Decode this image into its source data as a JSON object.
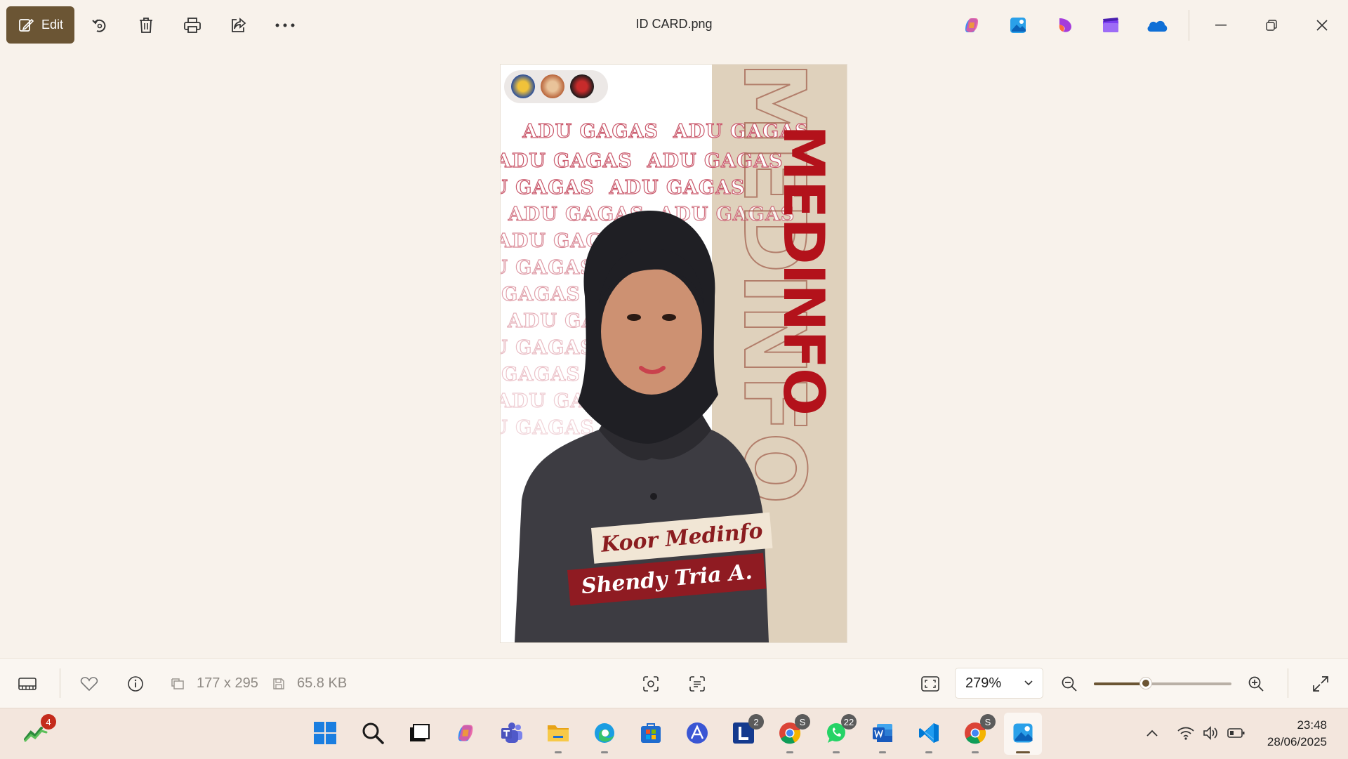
{
  "titlebar": {
    "edit_label": "Edit",
    "file_name": "ID CARD.png",
    "toolbar_icons": [
      "rotate-icon",
      "delete-icon",
      "print-icon",
      "share-icon",
      "more-icon"
    ],
    "app_icons": [
      "copilot-icon",
      "photos-icon",
      "designer-icon",
      "clipchamp-icon",
      "onedrive-icon"
    ],
    "window_controls": [
      "minimize-icon",
      "restore-icon",
      "close-icon"
    ]
  },
  "photo": {
    "pattern_text": "ADU GAGAS",
    "vertical_title": "MEDINFO",
    "role_label": "Koor Medinfo",
    "name_label": "Shendy Tria A."
  },
  "bottombar": {
    "dimensions": "177 x 295",
    "file_size": "65.8 KB",
    "zoom_value": "279%",
    "zoom_level_fraction": 0.38
  },
  "taskbar": {
    "apps": [
      {
        "name": "stocks-widget-icon",
        "badge": "4"
      },
      {
        "name": "start-icon",
        "badge": ""
      },
      {
        "name": "search-icon",
        "badge": ""
      },
      {
        "name": "task-view-icon",
        "badge": ""
      },
      {
        "name": "copilot-icon",
        "badge": ""
      },
      {
        "name": "teams-icon",
        "badge": ""
      },
      {
        "name": "file-explorer-icon",
        "badge": ""
      },
      {
        "name": "edge-icon",
        "badge": ""
      },
      {
        "name": "store-icon",
        "badge": ""
      },
      {
        "name": "altarix-icon",
        "badge": ""
      },
      {
        "name": "l-app-icon",
        "badge": "2"
      },
      {
        "name": "chrome-icon",
        "badge": "S"
      },
      {
        "name": "whatsapp-icon",
        "badge": "22"
      },
      {
        "name": "word-icon",
        "badge": ""
      },
      {
        "name": "vscode-icon",
        "badge": ""
      },
      {
        "name": "chrome-profile-icon",
        "badge": "S"
      },
      {
        "name": "photos-icon",
        "badge": ""
      }
    ],
    "time": "23:48",
    "date": "28/06/2025"
  }
}
